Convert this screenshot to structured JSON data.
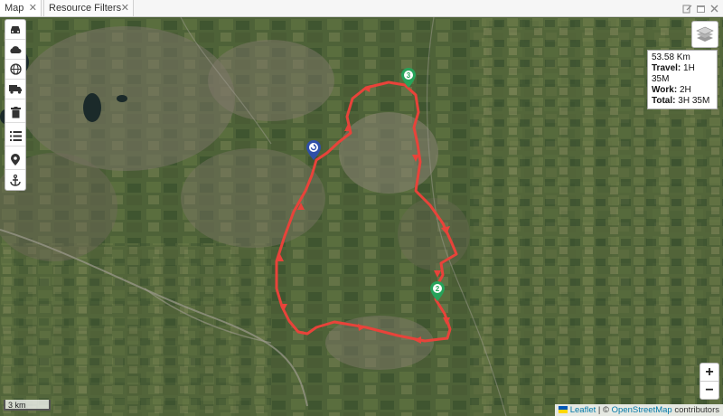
{
  "tabs": [
    {
      "label": "Map",
      "close": "✕"
    },
    {
      "label": "Resource Filters",
      "close": "✕"
    }
  ],
  "window_icons": [
    "edit-icon",
    "calendar-icon",
    "close-icon"
  ],
  "toolbar": {
    "buttons": [
      "car-icon",
      "cloud-icon",
      "globe-icon",
      "truck-icon",
      "trash-icon",
      "list-icon",
      "location-pin-icon",
      "anchor-icon"
    ]
  },
  "route_info": {
    "distance": "53.58 Km",
    "travel_label": "Travel:",
    "travel_value": "1H 35M",
    "work_label": "Work:",
    "work_value": "2H",
    "total_label": "Total:",
    "total_value": "3H 35M"
  },
  "markers": [
    {
      "label": "3",
      "color": "#27a35a"
    },
    {
      "label": "2",
      "color": "#27a35a"
    },
    {
      "label": "",
      "color": "#2f4fa8"
    }
  ],
  "zoom": {
    "in": "+",
    "out": "−"
  },
  "scale": "3 km",
  "attribution": {
    "leaflet": "Leaflet",
    "sep": " | © ",
    "osm": "OpenStreetMap",
    "contrib": " contributors"
  },
  "colors": {
    "route": "#e8433a",
    "marker_green": "#27a35a",
    "marker_blue": "#2f4fa8"
  }
}
